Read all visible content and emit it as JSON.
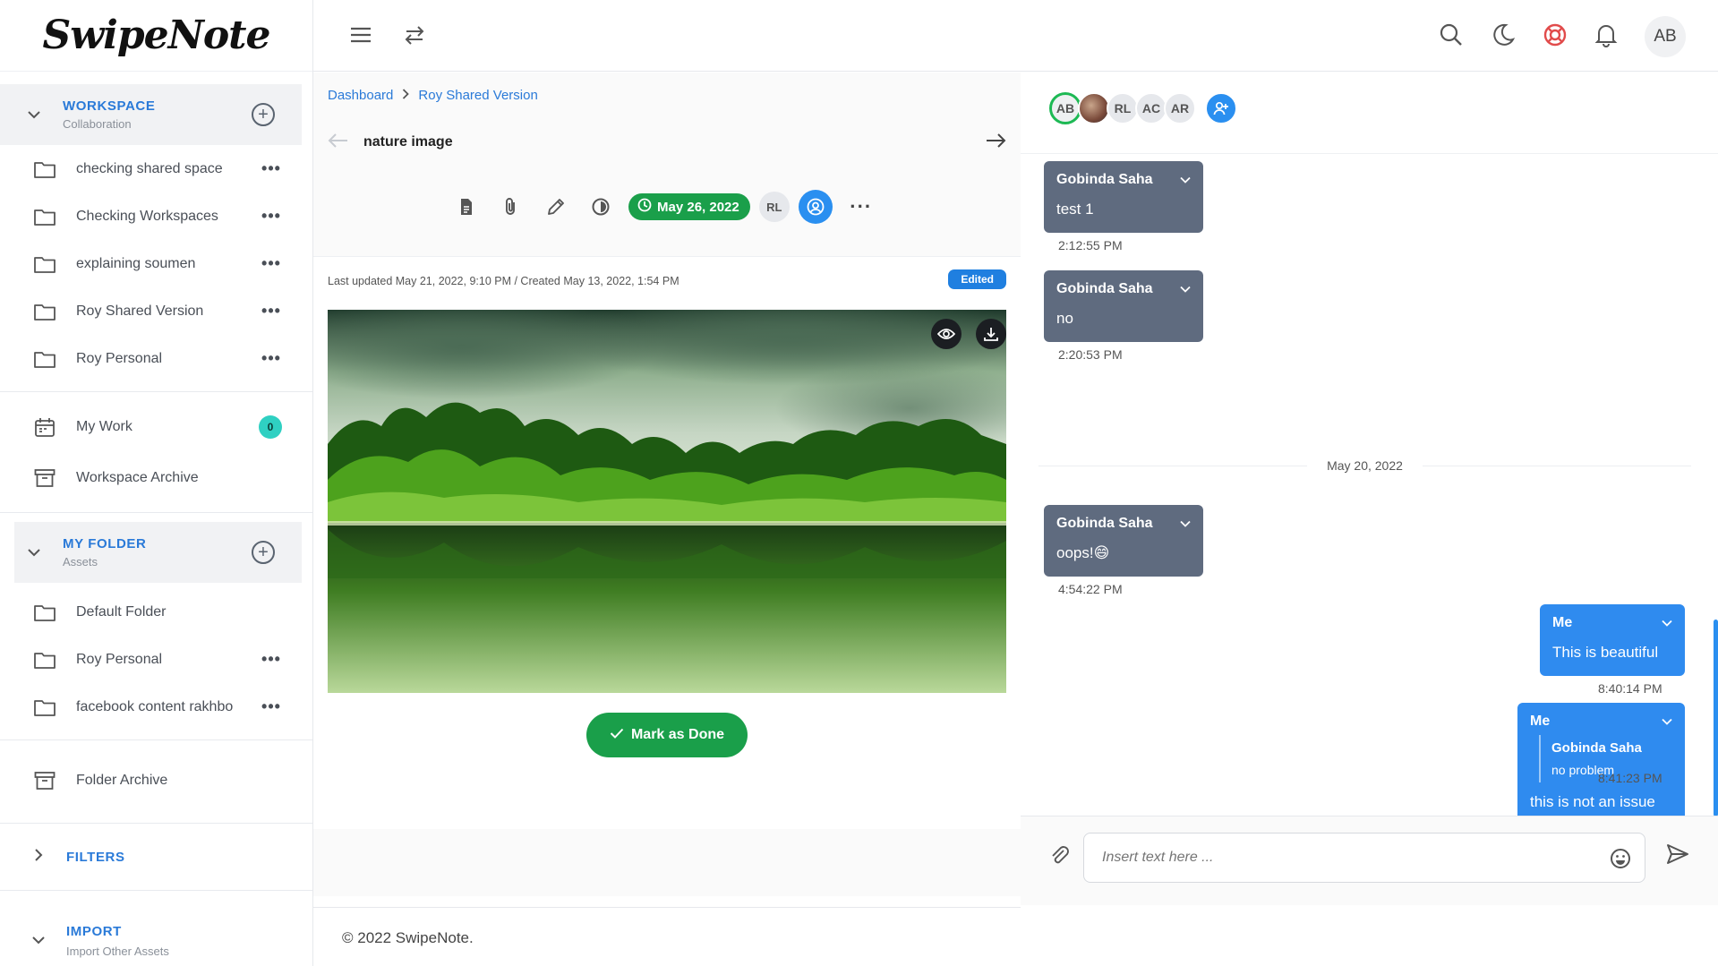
{
  "app": {
    "logo": "SwipeNote"
  },
  "sidebar": {
    "workspace": {
      "title": "WORKSPACE",
      "subtitle": "Collaboration"
    },
    "workspaces": [
      {
        "label": "checking shared space"
      },
      {
        "label": "Checking Workspaces"
      },
      {
        "label": "explaining soumen"
      },
      {
        "label": "Roy Shared Version"
      },
      {
        "label": "Roy Personal"
      }
    ],
    "my_work": {
      "label": "My Work",
      "count": "0"
    },
    "workspace_archive": {
      "label": "Workspace Archive"
    },
    "my_folder": {
      "title": "MY FOLDER",
      "subtitle": "Assets"
    },
    "folders": [
      {
        "label": "Default Folder"
      },
      {
        "label": "Roy Personal"
      },
      {
        "label": "facebook content rakhbo"
      }
    ],
    "folder_archive": {
      "label": "Folder Archive"
    },
    "filters": {
      "title": "FILTERS"
    },
    "import": {
      "title": "IMPORT",
      "subtitle": "Import Other Assets"
    }
  },
  "topbar": {
    "user_initials": "AB"
  },
  "note": {
    "breadcrumb": [
      "Dashboard",
      "Roy Shared Version"
    ],
    "title": "nature image",
    "due_date": "May 26, 2022",
    "assignee_initials": "RL",
    "meta": "Last updated May 21, 2022, 9:10 PM   /   Created May 13, 2022, 1:54 PM",
    "status_badge": "Edited",
    "mark_done_label": "Mark as Done"
  },
  "footer": {
    "copyright": "© 2022 SwipeNote."
  },
  "chat": {
    "members": [
      "AB",
      "RL",
      "AC",
      "AR"
    ],
    "messages": [
      {
        "sender": "Gobinda Saha",
        "text": "test 1",
        "time": "2:12:55 PM"
      },
      {
        "sender": "Gobinda Saha",
        "text": "no",
        "time": "2:20:53 PM"
      },
      {
        "sender": "Gobinda Saha",
        "text": "oops!😄",
        "time": "4:54:22 PM"
      },
      {
        "sender": "Me",
        "text": "This is beautiful",
        "time": "8:40:14 PM"
      },
      {
        "sender": "Me",
        "quote_sender": "Gobinda Saha",
        "quote_text": "no problem",
        "text": "this is not an issue",
        "time": "8:41:23 PM"
      }
    ],
    "day_separator": "May 20, 2022",
    "input_placeholder": "Insert text here ..."
  },
  "colors": {
    "accent": "#2a7ad8",
    "success": "#1a9f4a",
    "chat_other": "#5f6b7f",
    "chat_me": "#2f8bef"
  }
}
